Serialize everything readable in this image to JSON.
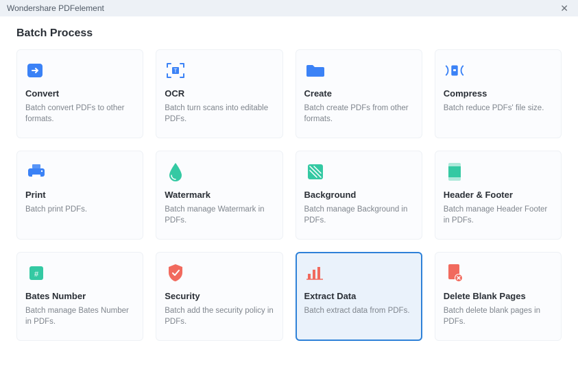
{
  "app_title": "Wondershare PDFelement",
  "page_title": "Batch Process",
  "cards": [
    {
      "id": "convert",
      "title": "Convert",
      "desc": "Batch convert PDFs to other formats.",
      "icon": "convert-icon",
      "selected": false
    },
    {
      "id": "ocr",
      "title": "OCR",
      "desc": "Batch turn scans into editable PDFs.",
      "icon": "ocr-icon",
      "selected": false
    },
    {
      "id": "create",
      "title": "Create",
      "desc": "Batch create PDFs from other formats.",
      "icon": "create-icon",
      "selected": false
    },
    {
      "id": "compress",
      "title": "Compress",
      "desc": "Batch reduce PDFs' file size.",
      "icon": "compress-icon",
      "selected": false
    },
    {
      "id": "print",
      "title": "Print",
      "desc": "Batch print PDFs.",
      "icon": "print-icon",
      "selected": false
    },
    {
      "id": "watermark",
      "title": "Watermark",
      "desc": "Batch manage Watermark in PDFs.",
      "icon": "watermark-icon",
      "selected": false
    },
    {
      "id": "background",
      "title": "Background",
      "desc": "Batch manage Background in PDFs.",
      "icon": "background-icon",
      "selected": false
    },
    {
      "id": "header-footer",
      "title": "Header & Footer",
      "desc": "Batch manage Header  Footer in PDFs.",
      "icon": "header-footer-icon",
      "selected": false
    },
    {
      "id": "bates-number",
      "title": "Bates Number",
      "desc": "Batch manage Bates Number in PDFs.",
      "icon": "bates-icon",
      "selected": false
    },
    {
      "id": "security",
      "title": "Security",
      "desc": "Batch add the security policy in PDFs.",
      "icon": "security-icon",
      "selected": false
    },
    {
      "id": "extract-data",
      "title": "Extract Data",
      "desc": "Batch extract data from PDFs.",
      "icon": "extract-icon",
      "selected": true
    },
    {
      "id": "delete-blank",
      "title": "Delete Blank Pages",
      "desc": "Batch delete blank pages in PDFs.",
      "icon": "delete-blank-icon",
      "selected": false
    }
  ],
  "colors": {
    "blue": "#3b82f6",
    "teal": "#34c9a3",
    "orange": "#f16a5e"
  }
}
